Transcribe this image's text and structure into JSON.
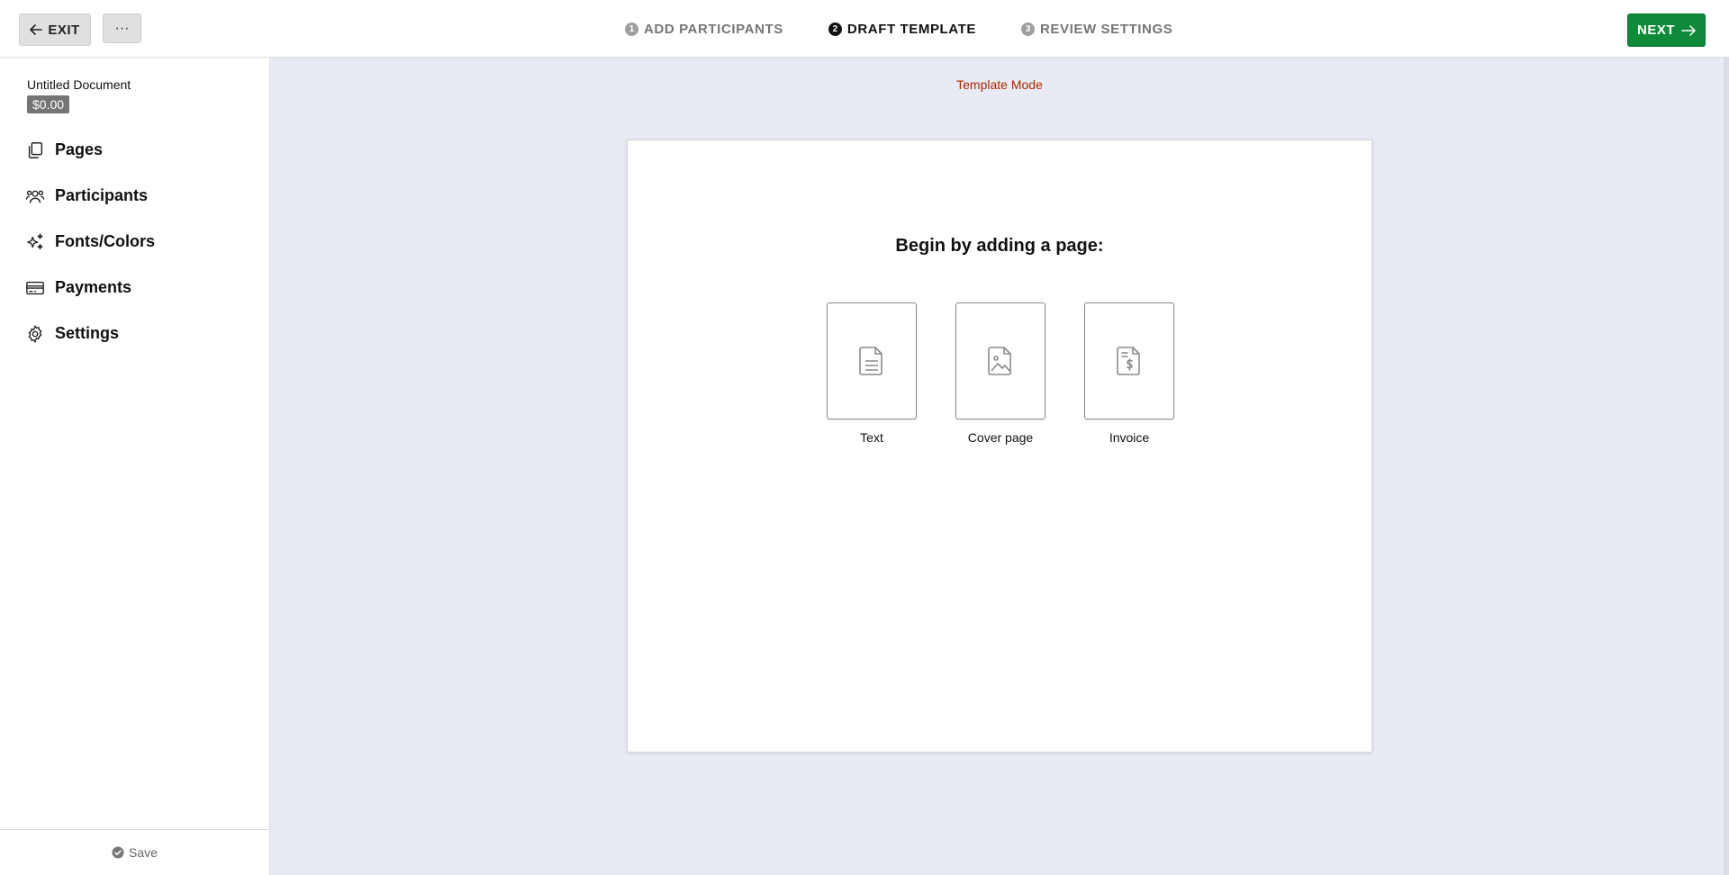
{
  "header": {
    "exit_label": "EXIT",
    "more_label": "···",
    "steps": [
      {
        "num": "1",
        "label": "ADD PARTICIPANTS"
      },
      {
        "num": "2",
        "label": "DRAFT TEMPLATE"
      },
      {
        "num": "3",
        "label": "REVIEW SETTINGS"
      }
    ],
    "active_step": 2,
    "next_label": "NEXT"
  },
  "sidebar": {
    "doc_title": "Untitled Document",
    "price": "$0.00",
    "items": [
      {
        "label": "Pages",
        "icon": "pages-icon"
      },
      {
        "label": "Participants",
        "icon": "participants-icon"
      },
      {
        "label": "Fonts/Colors",
        "icon": "sparkle-icon"
      },
      {
        "label": "Payments",
        "icon": "card-icon"
      },
      {
        "label": "Settings",
        "icon": "gear-icon"
      }
    ],
    "save_label": "Save"
  },
  "main": {
    "mode_label": "Template Mode",
    "begin_title": "Begin by adding a page:",
    "options": [
      {
        "label": "Text",
        "icon": "text-document-icon"
      },
      {
        "label": "Cover page",
        "icon": "image-document-icon"
      },
      {
        "label": "Invoice",
        "icon": "invoice-document-icon"
      }
    ]
  },
  "colors": {
    "accent_green": "#0e8a3a",
    "template_mode_red": "#a82a00",
    "canvas_bg": "#e8ebf4"
  }
}
